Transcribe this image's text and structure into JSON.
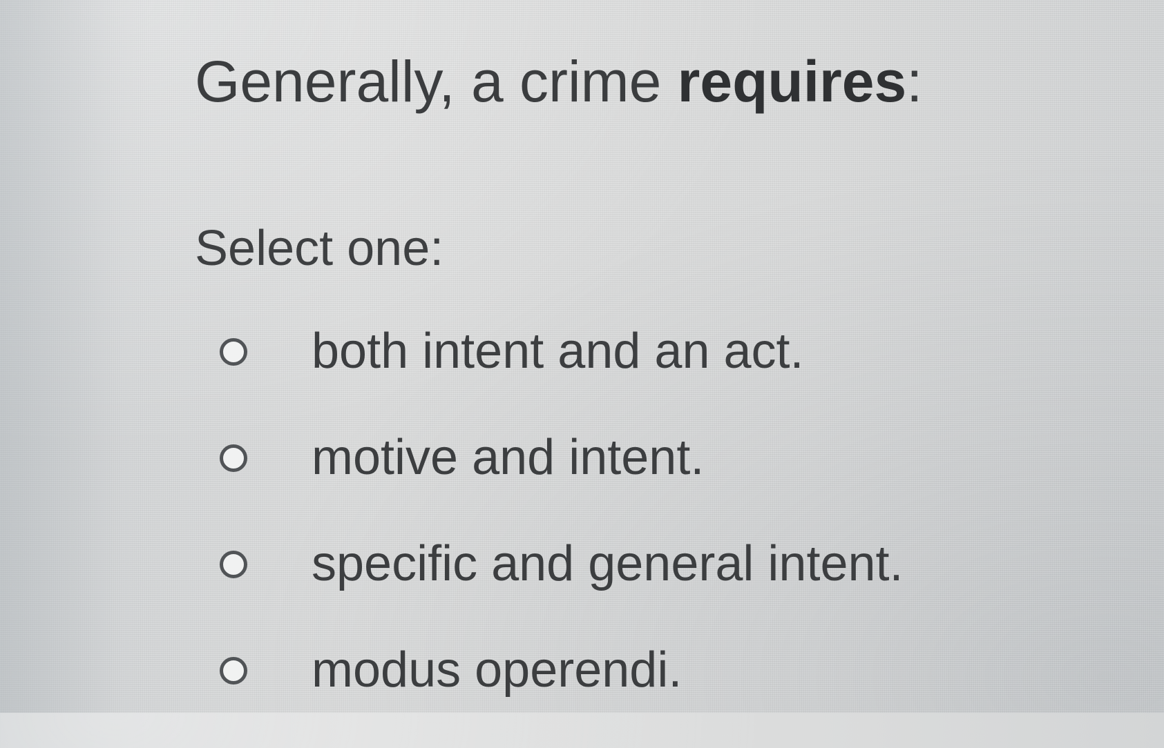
{
  "question": {
    "title_prefix": "Generally, a crime ",
    "title_emphasis": "requires",
    "title_suffix": ":",
    "prompt": "Select one:",
    "options": [
      {
        "label": "both intent and an act.",
        "selected": false
      },
      {
        "label": "motive and intent.",
        "selected": false
      },
      {
        "label": "specific and general intent.",
        "selected": false
      },
      {
        "label": "modus operendi.",
        "selected": false
      }
    ]
  },
  "colors": {
    "background": "#d9dbdb",
    "text": "#3c3e40",
    "radio_border": "#515457"
  }
}
